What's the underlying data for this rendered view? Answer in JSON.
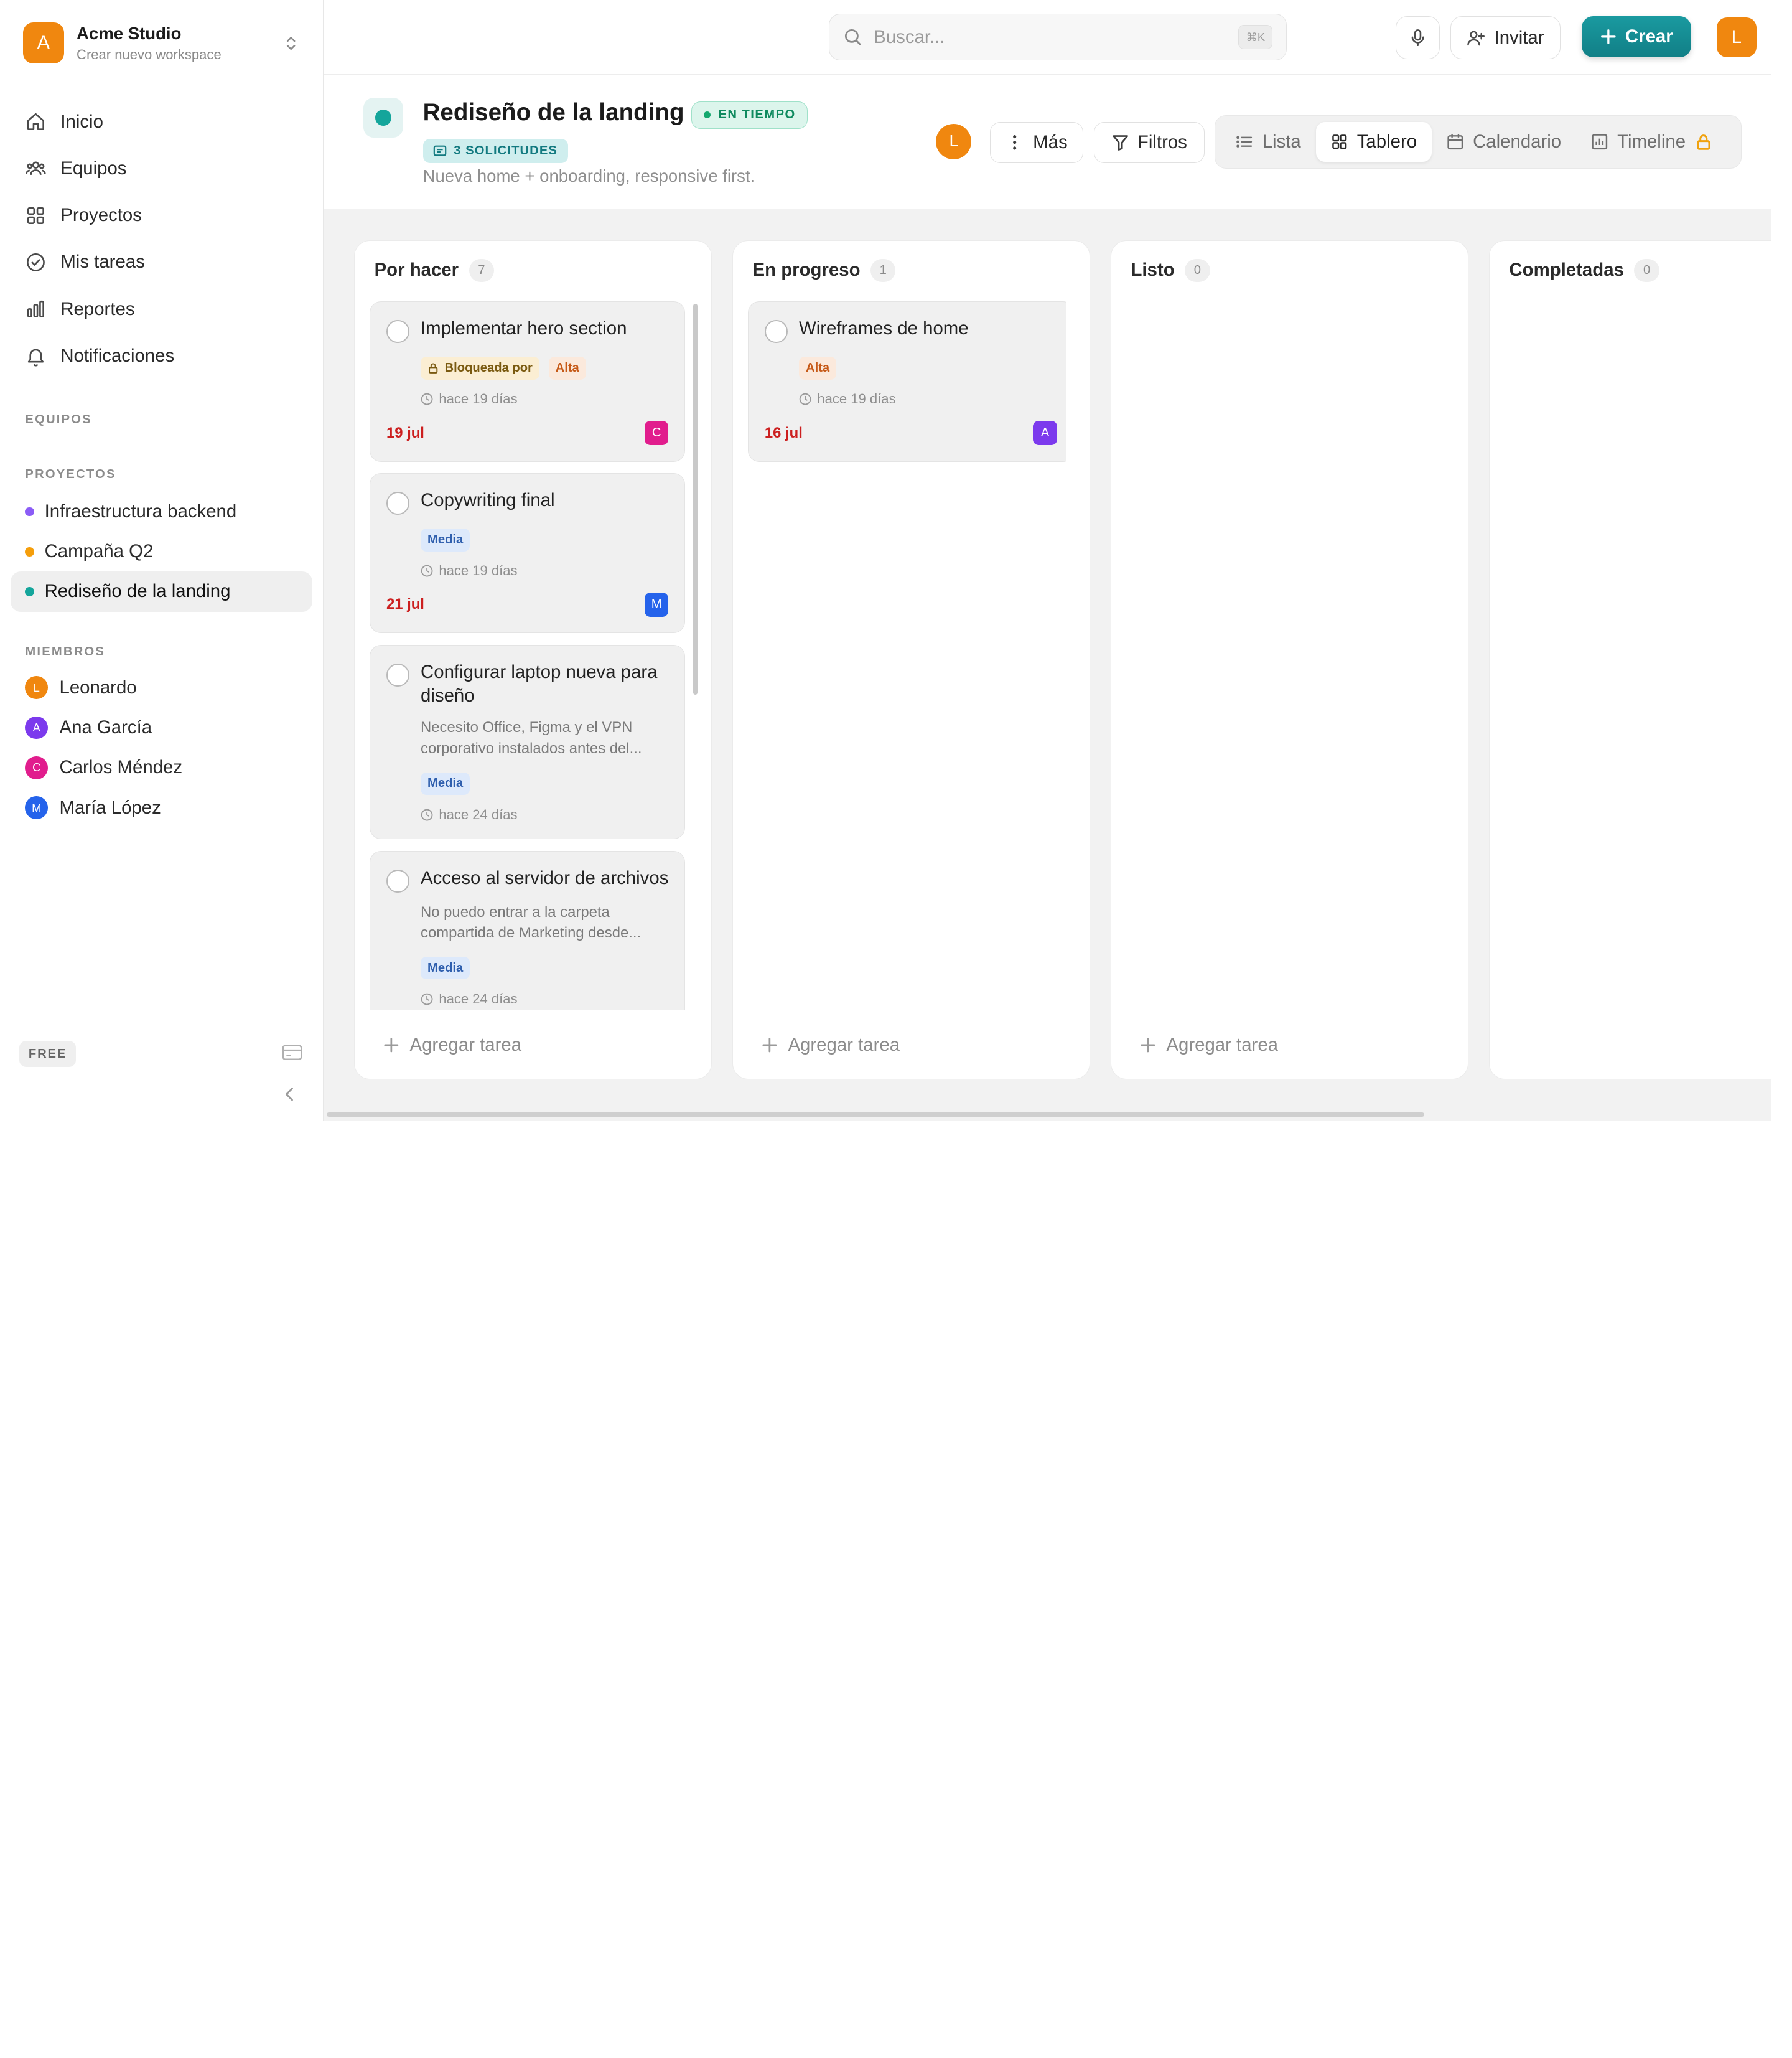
{
  "workspace": {
    "logo_letter": "A",
    "name": "Acme Studio",
    "subtitle": "Crear nuevo workspace"
  },
  "nav": [
    {
      "label": "Inicio",
      "icon": "home-icon"
    },
    {
      "label": "Equipos",
      "icon": "team-icon"
    },
    {
      "label": "Proyectos",
      "icon": "grid-icon"
    },
    {
      "label": "Mis tareas",
      "icon": "check-circle-icon"
    },
    {
      "label": "Reportes",
      "icon": "bar-chart-icon"
    },
    {
      "label": "Notificaciones",
      "icon": "bell-icon"
    }
  ],
  "sections": {
    "teams": "EQUIPOS",
    "projects": "PROYECTOS",
    "members": "MIEMBROS"
  },
  "projects": [
    {
      "label": "Infraestructura backend",
      "color": "#8b5cf6"
    },
    {
      "label": "Campaña Q2",
      "color": "#f59e0b"
    },
    {
      "label": "Rediseño de la landing",
      "color": "#14a59b",
      "active": true
    }
  ],
  "members": [
    {
      "initial": "L",
      "name": "Leonardo",
      "color": "#f0870f"
    },
    {
      "initial": "A",
      "name": "Ana García",
      "color": "#7c3aed"
    },
    {
      "initial": "C",
      "name": "Carlos Méndez",
      "color": "#e11d8d"
    },
    {
      "initial": "M",
      "name": "María López",
      "color": "#2563eb"
    }
  ],
  "footer": {
    "plan": "FREE"
  },
  "topbar": {
    "search_placeholder": "Buscar...",
    "search_shortcut": "⌘K",
    "invite_label": "Invitar",
    "create_label": "Crear",
    "user_initial": "L"
  },
  "project": {
    "title": "Rediseño de la landing",
    "status": "EN TIEMPO",
    "requests": "3 SOLICITUDES",
    "description": "Nueva home + onboarding, responsive first.",
    "owner_initial": "L",
    "more_label": "Más",
    "filters_label": "Filtros",
    "views": [
      {
        "label": "Lista",
        "icon": "list-icon"
      },
      {
        "label": "Tablero",
        "icon": "board-icon",
        "active": true
      },
      {
        "label": "Calendario",
        "icon": "calendar-icon"
      },
      {
        "label": "Timeline",
        "icon": "timeline-icon",
        "locked": true
      }
    ]
  },
  "board": {
    "add_task_label": "Agregar tarea",
    "columns": [
      {
        "title": "Por hacer",
        "count": "7",
        "cards": [
          {
            "title": "Implementar hero section",
            "tags": [
              {
                "label": "Bloqueada por",
                "kind": "blocked"
              },
              {
                "label": "Alta",
                "kind": "alta"
              }
            ],
            "time": "hace 19 días",
            "due": "19 jul",
            "assignee": "C",
            "assignee_color": "#e11d8d"
          },
          {
            "title": "Copywriting final",
            "tags": [
              {
                "label": "Media",
                "kind": "media"
              }
            ],
            "time": "hace 19 días",
            "due": "21 jul",
            "assignee": "M",
            "assignee_color": "#2563eb"
          },
          {
            "title": "Configurar laptop nueva para diseño",
            "desc": "Necesito Office, Figma y el VPN corporativo instalados antes del...",
            "tags": [
              {
                "label": "Media",
                "kind": "media"
              }
            ],
            "time": "hace 24 días"
          },
          {
            "title": "Acceso al servidor de archivos",
            "desc": "No puedo entrar a la carpeta compartida de Marketing desde...",
            "tags": [
              {
                "label": "Media",
                "kind": "media"
              }
            ],
            "time": "hace 24 días"
          }
        ]
      },
      {
        "title": "En progreso",
        "count": "1",
        "cards": [
          {
            "title": "Wireframes de home",
            "tags": [
              {
                "label": "Alta",
                "kind": "alta"
              }
            ],
            "time": "hace 19 días",
            "due": "16 jul",
            "assignee": "A",
            "assignee_color": "#7c3aed"
          }
        ]
      },
      {
        "title": "Listo",
        "count": "0",
        "cards": []
      },
      {
        "title": "Completadas",
        "count": "0",
        "cards": []
      }
    ]
  }
}
